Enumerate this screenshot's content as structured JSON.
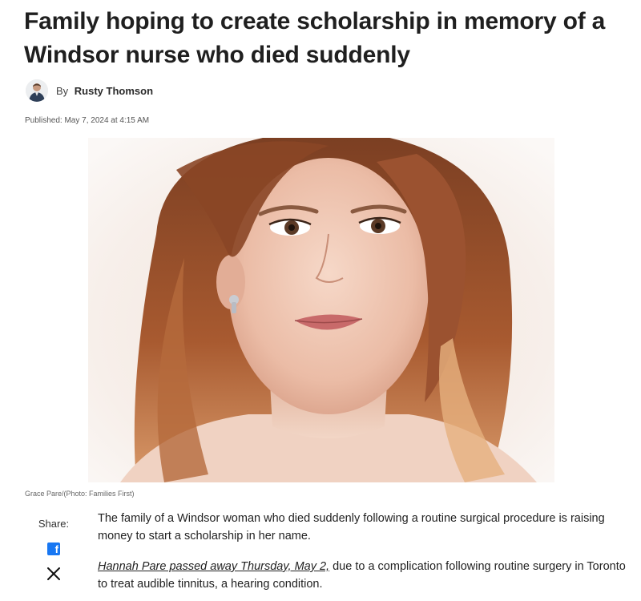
{
  "article": {
    "headline": "Family hoping to create scholarship in memory of a Windsor nurse who died suddenly",
    "byline_prefix": "By",
    "author": "Rusty Thomson",
    "published": "Published: May 7, 2024 at 4:15 AM",
    "photo_caption": "Grace Pare/(Photo: Families First)",
    "paragraphs": {
      "p1": "The family of a Windsor woman who died suddenly following a routine surgical procedure is raising money to start a scholarship in her name.",
      "p2_link": "Hannah Pare passed away Thursday, May 2,",
      "p2_rest": " due to a complication following routine surgery in Toronto to treat audible tinnitus, a hearing condition."
    }
  },
  "share": {
    "label": "Share:",
    "facebook_icon": "facebook-icon",
    "x_icon": "x-icon",
    "facebook_color": "#1877f2"
  },
  "icons": {
    "avatar": "author-avatar"
  }
}
